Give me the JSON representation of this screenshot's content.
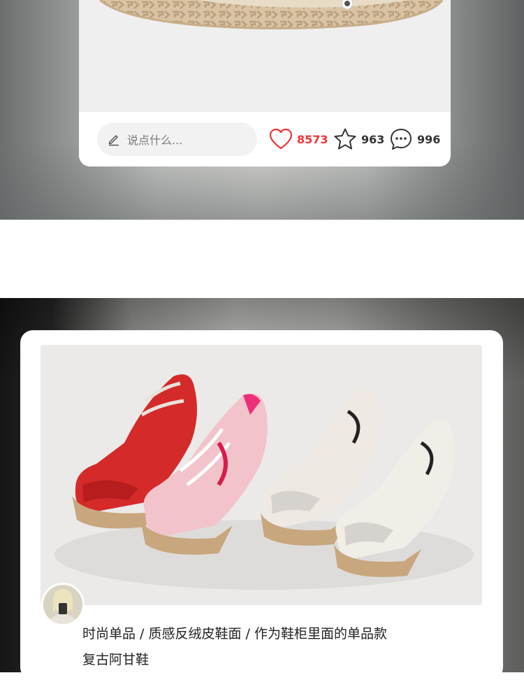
{
  "post_top": {
    "comment_placeholder": "说点什么...",
    "likes": "8573",
    "favorites": "963",
    "comments": "996",
    "icons": {
      "pencil": "pencil-icon",
      "like": "heart-icon",
      "favorite": "star-icon",
      "comment": "comment-bubble-icon"
    },
    "colors": {
      "like_accent": "#ef3438"
    }
  },
  "post_bottom": {
    "caption_line1": "时尚单品 / 质感反绒皮鞋面 / 作为鞋柜里面的单品款",
    "caption_line2": "复古阿甘鞋"
  }
}
